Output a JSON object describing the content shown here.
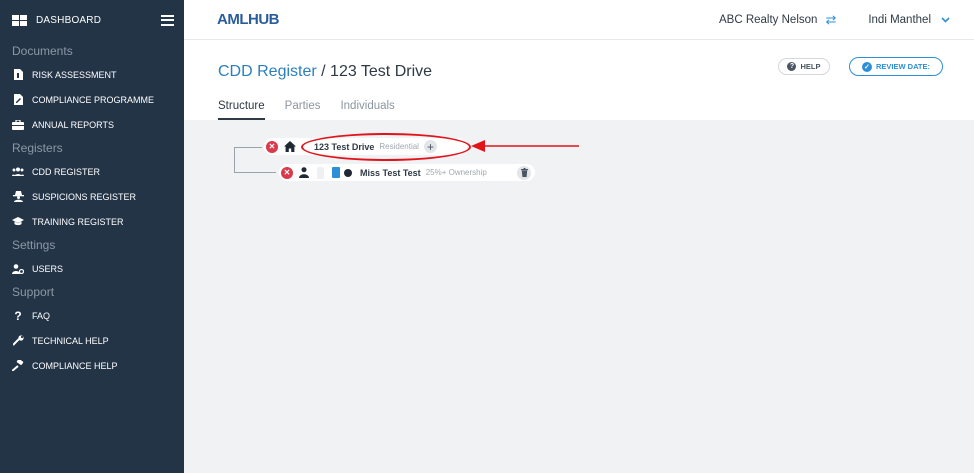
{
  "sidebar": {
    "dashboard_label": "DASHBOARD",
    "sections": {
      "documents": "Documents",
      "registers": "Registers",
      "settings": "Settings",
      "support": "Support"
    },
    "items": {
      "risk_assessment": "RISK ASSESSMENT",
      "compliance_programme": "COMPLIANCE PROGRAMME",
      "annual_reports": "ANNUAL REPORTS",
      "cdd_register": "CDD REGISTER",
      "suspicions_register": "SUSPICIONS REGISTER",
      "training_register": "TRAINING REGISTER",
      "users": "USERS",
      "faq": "FAQ",
      "technical_help": "TECHNICAL HELP",
      "compliance_help": "COMPLIANCE HELP"
    }
  },
  "topbar": {
    "logo": "AMLHUB",
    "organisation": "ABC Realty Nelson",
    "user_name": "Indi Manthel"
  },
  "header": {
    "breadcrumb_parent": "CDD Register",
    "breadcrumb_separator": "/",
    "property_name": "123 Test Drive",
    "help_label": "HELP",
    "review_label": "REVIEW DATE:",
    "tabs": [
      "Structure",
      "Parties",
      "Individuals"
    ]
  },
  "tree": {
    "root": {
      "name": "123 Test Drive",
      "type": "Residential"
    },
    "child": {
      "name": "Miss Test Test",
      "role": "25%+ Ownership"
    }
  },
  "colors": {
    "sidebar_bg": "#243447",
    "accent": "#2d8fd8",
    "delete_red": "#d9394a",
    "annotation_red": "#e1141c"
  }
}
